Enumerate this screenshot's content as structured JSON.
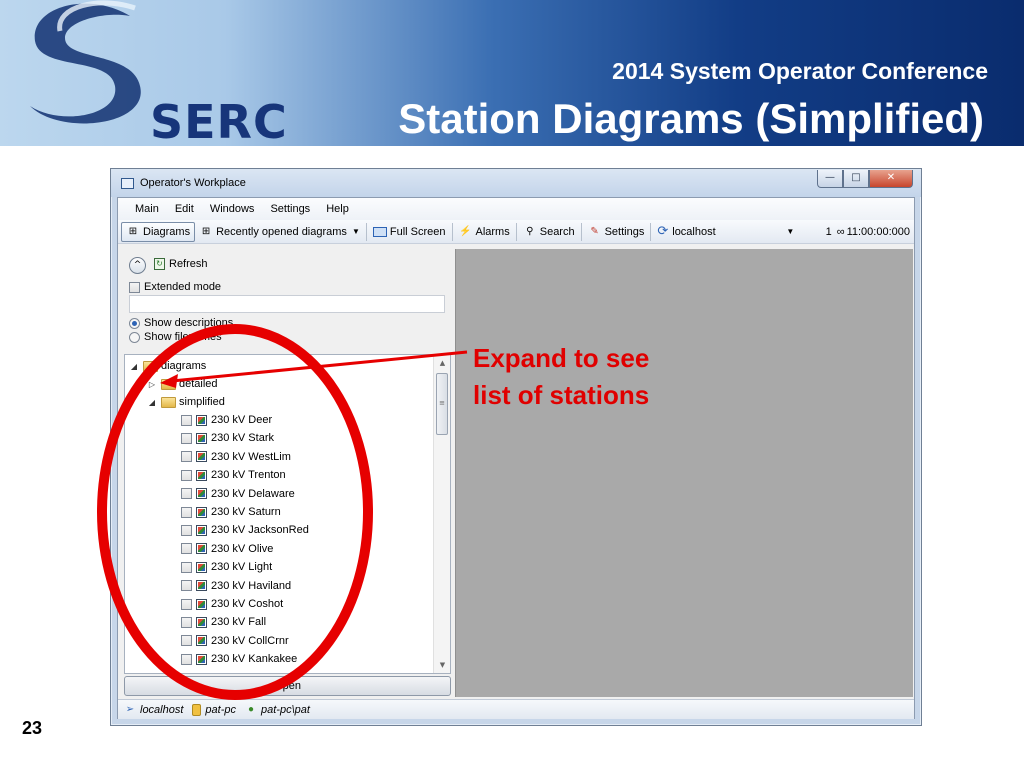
{
  "slide": {
    "brand": "SERC",
    "conference": "2014 System Operator Conference",
    "title": "Station Diagrams (Simplified)",
    "page_number": "23"
  },
  "window": {
    "title": "Operator's Workplace",
    "controls": {
      "minimize": "—",
      "maximize": "□",
      "close": "✕"
    }
  },
  "menu": [
    "Main",
    "Edit",
    "Windows",
    "Settings",
    "Help"
  ],
  "toolbar": {
    "diagrams": "Diagrams",
    "recent": "Recently opened diagrams",
    "fullscreen": "Full Screen",
    "alarms": "Alarms",
    "search": "Search",
    "settings": "Settings",
    "host": "localhost",
    "count": "1",
    "time": "11:00:00:000"
  },
  "options": {
    "refresh": "Refresh",
    "extended_mode": "Extended mode",
    "filter_value": "",
    "show_descriptions": "Show descriptions",
    "show_filenames": "Show filenames"
  },
  "tree": {
    "root": "diagrams",
    "detailed": "detailed",
    "simplified": "simplified",
    "stations": [
      "230 kV Deer",
      "230 kV Stark",
      "230 kV WestLim",
      "230 kV Trenton",
      "230 kV Delaware",
      "230 kV Saturn",
      "230 kV JacksonRed",
      "230 kV Olive",
      "230 kV Light",
      "230 kV Haviland",
      "230 kV Coshot",
      "230 kV Fall",
      "230 kV CollCrnr",
      "230 kV Kankakee"
    ]
  },
  "open_button": "Open",
  "status": {
    "host": "localhost",
    "machine": "pat-pc",
    "user": "pat-pc\\pat"
  },
  "annotation": {
    "line1": "Expand to see",
    "line2": "list of stations",
    "color": "#e00000"
  },
  "colors": {
    "viewer_background": "#a9a9a9",
    "banner_dark": "#0a2c6e"
  }
}
